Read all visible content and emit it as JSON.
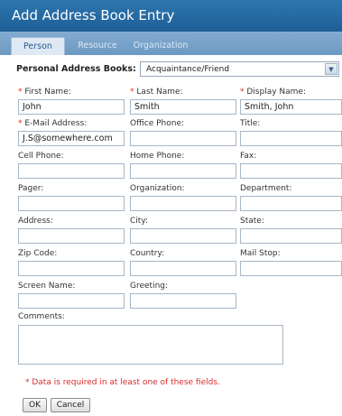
{
  "dialog": {
    "title": "Add Address Book Entry"
  },
  "tabs": [
    {
      "label": "Person",
      "active": true
    },
    {
      "label": "Resource",
      "active": false
    },
    {
      "label": "Organization",
      "active": false
    }
  ],
  "address_book": {
    "label": "Personal Address Books:",
    "selected": "Acquaintance/Friend"
  },
  "fields": {
    "first_name": {
      "label": "First Name:",
      "value": "John",
      "required": true
    },
    "last_name": {
      "label": "Last Name:",
      "value": "Smith",
      "required": true
    },
    "display_name": {
      "label": "Display Name:",
      "value": "Smith, John",
      "required": true
    },
    "email": {
      "label": "E-Mail Address:",
      "value": "J.S@somewhere.com",
      "required": true
    },
    "office_phone": {
      "label": "Office Phone:",
      "value": ""
    },
    "title": {
      "label": "Title:",
      "value": ""
    },
    "cell_phone": {
      "label": "Cell Phone:",
      "value": ""
    },
    "home_phone": {
      "label": "Home Phone:",
      "value": ""
    },
    "fax": {
      "label": "Fax:",
      "value": ""
    },
    "pager": {
      "label": "Pager:",
      "value": ""
    },
    "organization": {
      "label": "Organization:",
      "value": ""
    },
    "department": {
      "label": "Department:",
      "value": ""
    },
    "address": {
      "label": "Address:",
      "value": ""
    },
    "city": {
      "label": "City:",
      "value": ""
    },
    "state": {
      "label": "State:",
      "value": ""
    },
    "zip": {
      "label": "Zip Code:",
      "value": ""
    },
    "country": {
      "label": "Country:",
      "value": ""
    },
    "mail_stop": {
      "label": "Mail Stop:",
      "value": ""
    },
    "screen_name": {
      "label": "Screen Name:",
      "value": ""
    },
    "greeting": {
      "label": "Greeting:",
      "value": ""
    },
    "comments": {
      "label": "Comments:",
      "value": ""
    }
  },
  "required_mark": "*",
  "required_note": "* Data is required in at least one of these fields.",
  "buttons": {
    "ok": "OK",
    "cancel": "Cancel"
  },
  "colors": {
    "title_bar": "#2266a8",
    "tab_strip": "#7aa3cb",
    "required": "#d92b2b"
  }
}
